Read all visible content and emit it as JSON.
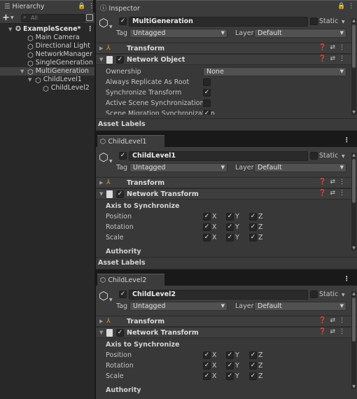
{
  "hierarchy": {
    "tab_label": "Hierarchy",
    "add_glyph": "+",
    "search_placeholder": "All",
    "items": [
      {
        "label": "ExampleScene*",
        "depth": 0,
        "kind": "scene"
      },
      {
        "label": "Main Camera",
        "depth": 1,
        "kind": "object"
      },
      {
        "label": "Directional Light",
        "depth": 1,
        "kind": "object"
      },
      {
        "label": "NetworkManager",
        "depth": 1,
        "kind": "object"
      },
      {
        "label": "SingleGeneration",
        "depth": 1,
        "kind": "object"
      },
      {
        "label": "MultiGeneration",
        "depth": 1,
        "kind": "object",
        "selected": true
      },
      {
        "label": "ChildLevel1",
        "depth": 2,
        "kind": "object"
      },
      {
        "label": "ChildLevel2",
        "depth": 3,
        "kind": "object"
      }
    ]
  },
  "inspector": {
    "tab_label": "Inspector",
    "main": {
      "object_name": "MultiGeneration",
      "static_label": "Static",
      "tag_label": "Tag",
      "tag_value": "Untagged",
      "layer_label": "Layer",
      "layer_value": "Default",
      "transform_title": "Transform",
      "component_title": "Network Object",
      "fields": [
        {
          "label": "Ownership",
          "type": "dropdown",
          "value": "None"
        },
        {
          "label": "Always Replicate As Root",
          "type": "checkbox",
          "checked": false
        },
        {
          "label": "Synchronize Transform",
          "type": "checkbox",
          "checked": true
        },
        {
          "label": "Active Scene Synchronization",
          "type": "checkbox",
          "checked": false
        },
        {
          "label": "Scene Migration Synchronization",
          "type": "checkbox",
          "checked": true
        }
      ],
      "asset_labels": "Asset Labels"
    },
    "panels": [
      {
        "tab_label": "ChildLevel1",
        "object_name": "ChildLevel1",
        "static_label": "Static",
        "tag_label": "Tag",
        "tag_value": "Untagged",
        "layer_label": "Layer",
        "layer_value": "Default",
        "transform_title": "Transform",
        "component_title": "Network Transform",
        "axis_title": "Axis to Synchronize",
        "rows": [
          "Position",
          "Rotation",
          "Scale"
        ],
        "axes": [
          "X",
          "Y",
          "Z"
        ],
        "authority_label": "Authority",
        "asset_labels": "Asset Labels"
      },
      {
        "tab_label": "ChildLevel2",
        "object_name": "ChildLevel2",
        "static_label": "Static",
        "tag_label": "Tag",
        "tag_value": "Untagged",
        "layer_label": "Layer",
        "layer_value": "Default",
        "transform_title": "Transform",
        "component_title": "Network Transform",
        "axis_title": "Axis to Synchronize",
        "rows": [
          "Position",
          "Rotation",
          "Scale"
        ],
        "axes": [
          "X",
          "Y",
          "Z"
        ],
        "authority_label": "Authority"
      }
    ]
  },
  "glyphs": {
    "check": "✓",
    "kebab": "⋮",
    "fold_closed": "▶",
    "fold_open": "▼",
    "dropdown": "▼"
  },
  "colors": {
    "selection": "#404040",
    "background": "#383838",
    "panel_dark": "#191919"
  }
}
